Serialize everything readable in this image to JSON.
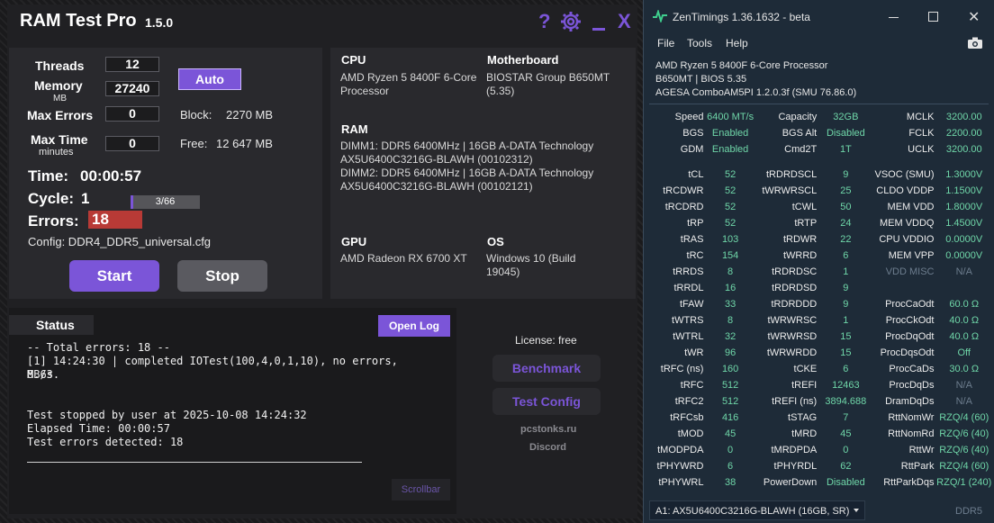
{
  "ramtest": {
    "title": "RAM Test Pro",
    "version": "1.5.0",
    "threads_label": "Threads",
    "threads_value": "12",
    "memory_label": "Memory",
    "memory_unit": "MB",
    "memory_value": "27240",
    "auto_label": "Auto",
    "max_errors_label": "Max Errors",
    "max_errors_value": "0",
    "block_label": "Block:",
    "block_value": "2270 MB",
    "max_time_label": "Max Time",
    "max_time_unit": "minutes",
    "max_time_value": "0",
    "free_label": "Free:",
    "free_value": "12 647 MB",
    "time_label": "Time:",
    "time_value": "00:00:57",
    "cycle_label": "Cycle:",
    "cycle_value": "1",
    "cycle_progress": "3/66",
    "cycle_fraction": 0.045,
    "errors_label": "Errors:",
    "errors_value": "18",
    "config_label": "Config: DDR4_DDR5_universal.cfg",
    "start_label": "Start",
    "stop_label": "Stop",
    "cpu_label": "CPU",
    "cpu_value": "AMD Ryzen 5 8400F 6-Core Processor",
    "mb_label": "Motherboard",
    "mb_value": "BIOSTAR Group B650MT (5.35)",
    "ram_label": "RAM",
    "ram_lines": [
      "DIMM1: DDR5 6400MHz | 16GB A-DATA Technology",
      "AX5U6400C3216G-BLAWH (00102312)",
      "DIMM2: DDR5 6400MHz | 16GB A-DATA Technology",
      "AX5U6400C3216G-BLAWH (00102121)"
    ],
    "gpu_label": "GPU",
    "gpu_value": "AMD Radeon RX 6700 XT",
    "os_label": "OS",
    "os_value": "Windows 10 (Build 19045)",
    "status_label": "Status",
    "open_log_label": "Open Log",
    "log_lines": [
      "-- Total errors: 18 --",
      "[1] 14:24:30 | completed IOTest(100,4,0,1,10), no errors, 8.63",
      "MB/s.",
      "",
      "",
      "Test stopped by user at 2025-10-08 14:24:32",
      "Elapsed Time: 00:00:57",
      "Test errors detected: 18"
    ],
    "scrollbar_label": "Scrollbar",
    "license_label": "License: free",
    "benchmark_label": "Benchmark",
    "test_config_label": "Test Config",
    "site_label": "pcstonks.ru",
    "discord_label": "Discord",
    "accent": "#7b55d8",
    "error_color": "#b83a36"
  },
  "zen": {
    "title": "ZenTimings 1.36.1632 - beta",
    "menu": [
      "File",
      "Tools",
      "Help"
    ],
    "info_lines": [
      "AMD Ryzen 5 8400F 6-Core Processor",
      "B650MT | BIOS 5.35",
      "AGESA ComboAM5PI 1.2.0.3f (SMU 76.86.0)"
    ],
    "top_rows": [
      [
        "Speed",
        "6400 MT/s",
        "Capacity",
        "32GB",
        "MCLK",
        "3200.00"
      ],
      [
        "BGS",
        "Enabled",
        "BGS Alt",
        "Disabled",
        "FCLK",
        "2200.00"
      ],
      [
        "GDM",
        "Enabled",
        "Cmd2T",
        "1T",
        "UCLK",
        "3200.00"
      ]
    ],
    "rows": [
      [
        "tCL",
        "52",
        "tRDRDSCL",
        "9",
        "VSOC (SMU)",
        "1.3000V"
      ],
      [
        "tRCDWR",
        "52",
        "tWRWRSCL",
        "25",
        "CLDO VDDP",
        "1.1500V"
      ],
      [
        "tRCDRD",
        "52",
        "tCWL",
        "50",
        "MEM VDD",
        "1.8000V"
      ],
      [
        "tRP",
        "52",
        "tRTP",
        "24",
        "MEM VDDQ",
        "1.4500V"
      ],
      [
        "tRAS",
        "103",
        "tRDWR",
        "22",
        "CPU VDDIO",
        "0.0000V"
      ],
      [
        "tRC",
        "154",
        "tWRRD",
        "6",
        "MEM VPP",
        "0.0000V"
      ],
      [
        "tRRDS",
        "8",
        "tRDRDSC",
        "1",
        "VDD MISC",
        "N/A"
      ],
      [
        "tRRDL",
        "16",
        "tRDRDSD",
        "9",
        "",
        ""
      ],
      [
        "tFAW",
        "33",
        "tRDRDDD",
        "9",
        "ProcCaOdt",
        "60.0 Ω"
      ],
      [
        "tWTRS",
        "8",
        "tWRWRSC",
        "1",
        "ProcCkOdt",
        "40.0 Ω"
      ],
      [
        "tWTRL",
        "32",
        "tWRWRSD",
        "15",
        "ProcDqOdt",
        "40.0 Ω"
      ],
      [
        "tWR",
        "96",
        "tWRWRDD",
        "15",
        "ProcDqsOdt",
        "Off"
      ],
      [
        "tRFC (ns)",
        "160",
        "tCKE",
        "6",
        "ProcCaDs",
        "30.0 Ω"
      ],
      [
        "tRFC",
        "512",
        "tREFI",
        "12463",
        "ProcDqDs",
        "N/A"
      ],
      [
        "tRFC2",
        "512",
        "tREFI (ns)",
        "3894.688",
        "DramDqDs",
        "N/A"
      ],
      [
        "tRFCsb",
        "416",
        "tSTAG",
        "7",
        "RttNomWr",
        "RZQ/4 (60)"
      ],
      [
        "tMOD",
        "45",
        "tMRD",
        "45",
        "RttNomRd",
        "RZQ/6 (40)"
      ],
      [
        "tMODPDA",
        "0",
        "tMRDPDA",
        "0",
        "RttWr",
        "RZQ/6 (40)"
      ],
      [
        "tPHYWRD",
        "6",
        "tPHYRDL",
        "62",
        "RttPark",
        "RZQ/4 (60)"
      ],
      [
        "tPHYWRL",
        "38",
        "PowerDown",
        "Disabled",
        "RttParkDqs",
        "RZQ/1 (240)"
      ]
    ],
    "dimm_select": "A1: AX5U6400C3216G-BLAWH (16GB, SR)",
    "ddr_label": "DDR5",
    "value_color": "#6fd6a8"
  }
}
